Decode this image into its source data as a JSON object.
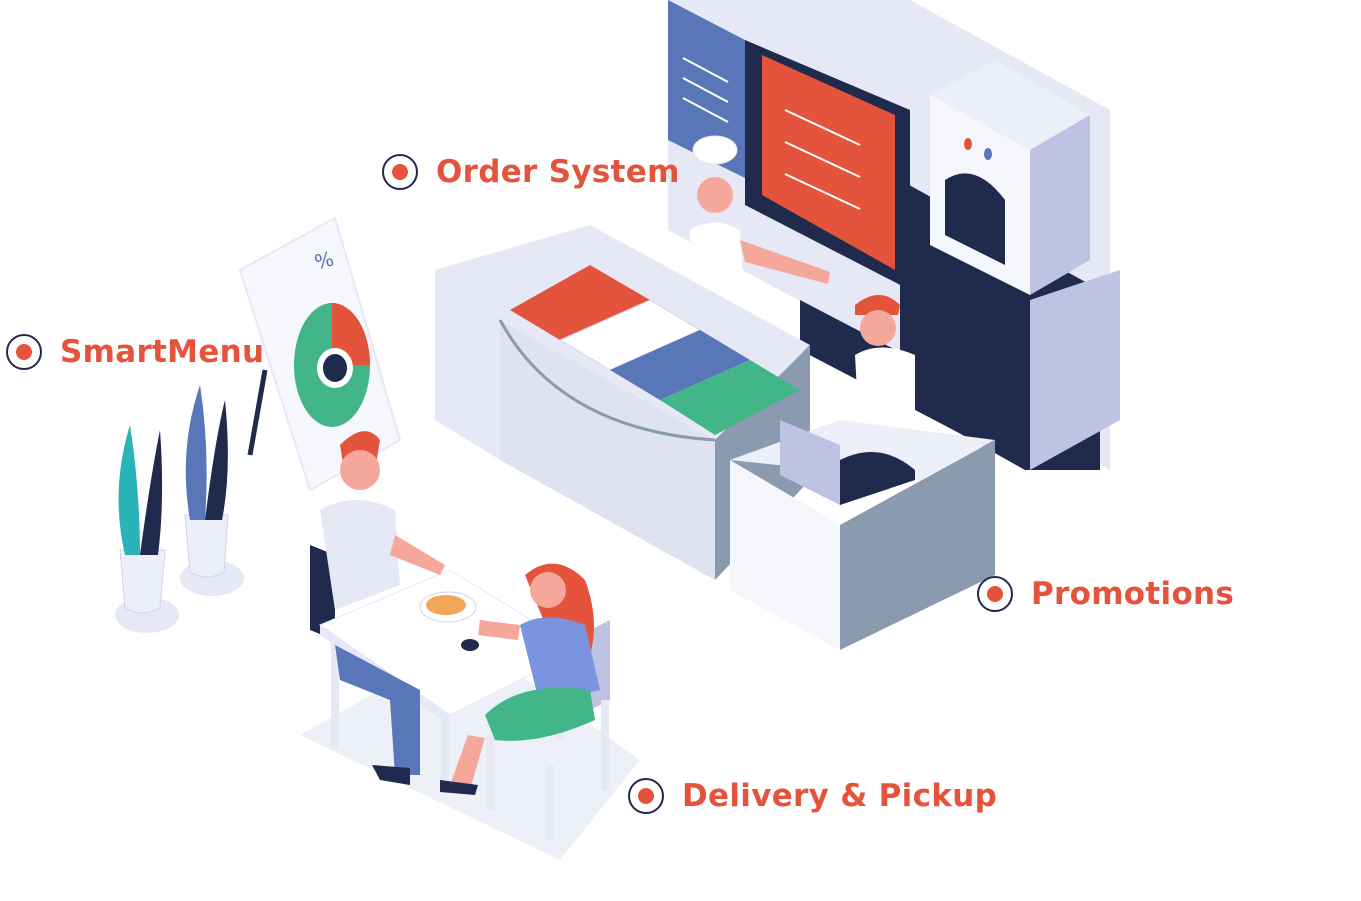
{
  "hotspots": {
    "order_system": "Order System",
    "smart_menu": "SmartMenu",
    "promotions": "Promotions",
    "delivery_pickup": "Delivery & Pickup"
  },
  "sign": {
    "symbol": "%"
  },
  "colors": {
    "accent": "#e4533b",
    "navy": "#1f2a4d",
    "blue": "#5876b8",
    "green": "#43b689",
    "lavender": "#bfc3e3",
    "light": "#e6e8f5"
  }
}
